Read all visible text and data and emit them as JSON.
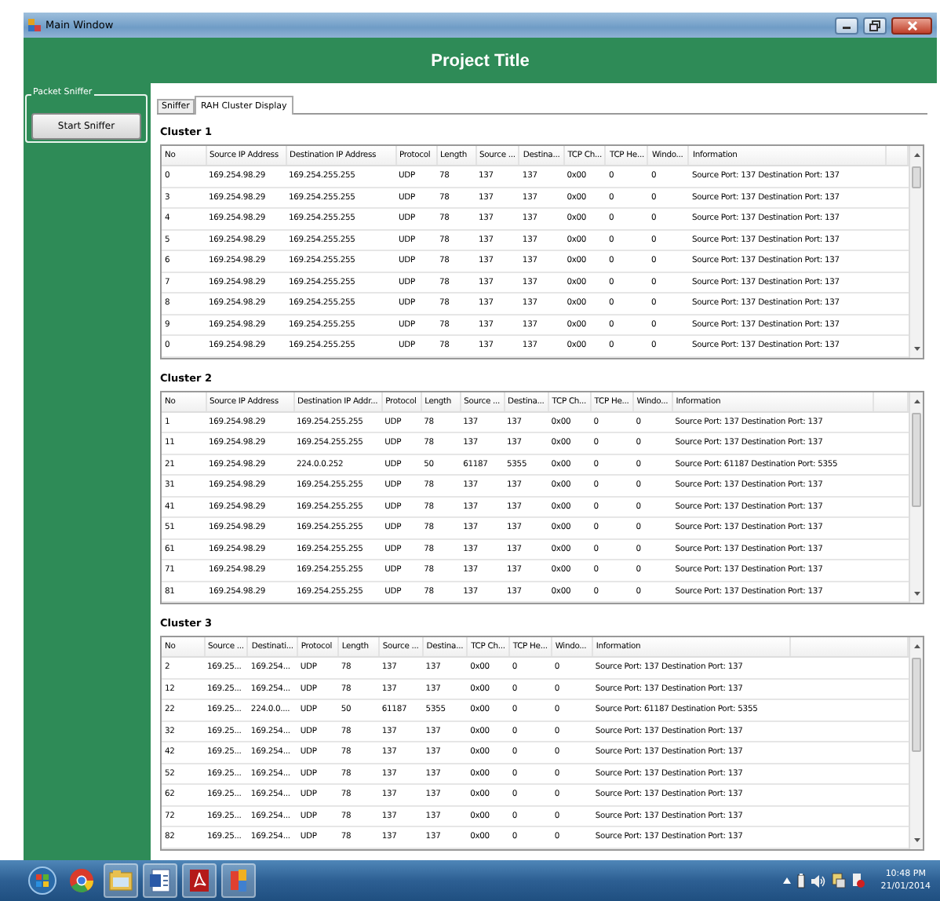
{
  "window": {
    "title": "Main Window"
  },
  "header": {
    "title": "Project Title"
  },
  "sidebar": {
    "group_title": "Packet Sniffer",
    "button": "Start Sniffer"
  },
  "tabs": [
    {
      "label": "Sniffer",
      "selected": false
    },
    {
      "label": "RAH Cluster Display",
      "selected": true
    }
  ],
  "clusters": [
    {
      "title": "Cluster 1",
      "columns": [
        "No",
        "Source IP Address",
        "Destination IP Address",
        "Protocol",
        "Length",
        "Source ...",
        "Destina...",
        "TCP Ch...",
        "TCP He...",
        "Windo...",
        "Information"
      ],
      "rows": [
        [
          "0",
          "169.254.98.29",
          "169.254.255.255",
          "UDP",
          "78",
          "137",
          "137",
          "0x00",
          "0",
          "0",
          "Source Port: 137  Destination Port: 137"
        ],
        [
          "3",
          "169.254.98.29",
          "169.254.255.255",
          "UDP",
          "78",
          "137",
          "137",
          "0x00",
          "0",
          "0",
          "Source Port: 137  Destination Port: 137"
        ],
        [
          "4",
          "169.254.98.29",
          "169.254.255.255",
          "UDP",
          "78",
          "137",
          "137",
          "0x00",
          "0",
          "0",
          "Source Port: 137  Destination Port: 137"
        ],
        [
          "5",
          "169.254.98.29",
          "169.254.255.255",
          "UDP",
          "78",
          "137",
          "137",
          "0x00",
          "0",
          "0",
          "Source Port: 137  Destination Port: 137"
        ],
        [
          "6",
          "169.254.98.29",
          "169.254.255.255",
          "UDP",
          "78",
          "137",
          "137",
          "0x00",
          "0",
          "0",
          "Source Port: 137  Destination Port: 137"
        ],
        [
          "7",
          "169.254.98.29",
          "169.254.255.255",
          "UDP",
          "78",
          "137",
          "137",
          "0x00",
          "0",
          "0",
          "Source Port: 137  Destination Port: 137"
        ],
        [
          "8",
          "169.254.98.29",
          "169.254.255.255",
          "UDP",
          "78",
          "137",
          "137",
          "0x00",
          "0",
          "0",
          "Source Port: 137  Destination Port: 137"
        ],
        [
          "9",
          "169.254.98.29",
          "169.254.255.255",
          "UDP",
          "78",
          "137",
          "137",
          "0x00",
          "0",
          "0",
          "Source Port: 137  Destination Port: 137"
        ],
        [
          "0",
          "169.254.98.29",
          "169.254.255.255",
          "UDP",
          "78",
          "137",
          "137",
          "0x00",
          "0",
          "0",
          "Source Port: 137  Destination Port: 137"
        ]
      ]
    },
    {
      "title": "Cluster 2",
      "columns": [
        "No",
        "Source IP Address",
        "Destination IP Addr...",
        "Protocol",
        "Length",
        "Source ...",
        "Destina...",
        "TCP Ch...",
        "TCP He...",
        "Windo...",
        "Information"
      ],
      "rows": [
        [
          "1",
          "169.254.98.29",
          "169.254.255.255",
          "UDP",
          "78",
          "137",
          "137",
          "0x00",
          "0",
          "0",
          "Source Port: 137  Destination Port: 137"
        ],
        [
          "11",
          "169.254.98.29",
          "169.254.255.255",
          "UDP",
          "78",
          "137",
          "137",
          "0x00",
          "0",
          "0",
          "Source Port: 137  Destination Port: 137"
        ],
        [
          "21",
          "169.254.98.29",
          "224.0.0.252",
          "UDP",
          "50",
          "61187",
          "5355",
          "0x00",
          "0",
          "0",
          "Source Port: 61187  Destination Port: 5355"
        ],
        [
          "31",
          "169.254.98.29",
          "169.254.255.255",
          "UDP",
          "78",
          "137",
          "137",
          "0x00",
          "0",
          "0",
          "Source Port: 137  Destination Port: 137"
        ],
        [
          "41",
          "169.254.98.29",
          "169.254.255.255",
          "UDP",
          "78",
          "137",
          "137",
          "0x00",
          "0",
          "0",
          "Source Port: 137  Destination Port: 137"
        ],
        [
          "51",
          "169.254.98.29",
          "169.254.255.255",
          "UDP",
          "78",
          "137",
          "137",
          "0x00",
          "0",
          "0",
          "Source Port: 137  Destination Port: 137"
        ],
        [
          "61",
          "169.254.98.29",
          "169.254.255.255",
          "UDP",
          "78",
          "137",
          "137",
          "0x00",
          "0",
          "0",
          "Source Port: 137  Destination Port: 137"
        ],
        [
          "71",
          "169.254.98.29",
          "169.254.255.255",
          "UDP",
          "78",
          "137",
          "137",
          "0x00",
          "0",
          "0",
          "Source Port: 137  Destination Port: 137"
        ],
        [
          "81",
          "169.254.98.29",
          "169.254.255.255",
          "UDP",
          "78",
          "137",
          "137",
          "0x00",
          "0",
          "0",
          "Source Port: 137  Destination Port: 137"
        ]
      ]
    },
    {
      "title": "Cluster 3",
      "columns": [
        "No",
        "Source ...",
        "Destinati...",
        "Protocol",
        "Length",
        "Source ...",
        "Destina...",
        "TCP Ch...",
        "TCP He...",
        "Windo...",
        "Information"
      ],
      "rows": [
        [
          "2",
          "169.25...",
          "169.254...",
          "UDP",
          "78",
          "137",
          "137",
          "0x00",
          "0",
          "0",
          "Source Port: 137  Destination Port: 137"
        ],
        [
          "12",
          "169.25...",
          "169.254...",
          "UDP",
          "78",
          "137",
          "137",
          "0x00",
          "0",
          "0",
          "Source Port: 137  Destination Port: 137"
        ],
        [
          "22",
          "169.25...",
          "224.0.0....",
          "UDP",
          "50",
          "61187",
          "5355",
          "0x00",
          "0",
          "0",
          "Source Port: 61187  Destination Port: 5355"
        ],
        [
          "32",
          "169.25...",
          "169.254...",
          "UDP",
          "78",
          "137",
          "137",
          "0x00",
          "0",
          "0",
          "Source Port: 137  Destination Port: 137"
        ],
        [
          "42",
          "169.25...",
          "169.254...",
          "UDP",
          "78",
          "137",
          "137",
          "0x00",
          "0",
          "0",
          "Source Port: 137  Destination Port: 137"
        ],
        [
          "52",
          "169.25...",
          "169.254...",
          "UDP",
          "78",
          "137",
          "137",
          "0x00",
          "0",
          "0",
          "Source Port: 137  Destination Port: 137"
        ],
        [
          "62",
          "169.25...",
          "169.254...",
          "UDP",
          "78",
          "137",
          "137",
          "0x00",
          "0",
          "0",
          "Source Port: 137  Destination Port: 137"
        ],
        [
          "72",
          "169.25...",
          "169.254...",
          "UDP",
          "78",
          "137",
          "137",
          "0x00",
          "0",
          "0",
          "Source Port: 137  Destination Port: 137"
        ],
        [
          "82",
          "169.25...",
          "169.254...",
          "UDP",
          "78",
          "137",
          "137",
          "0x00",
          "0",
          "0",
          "Source Port: 137  Destination Port: 137"
        ]
      ]
    }
  ],
  "clock": {
    "time": "10:48 PM",
    "date": "21/01/2014"
  }
}
